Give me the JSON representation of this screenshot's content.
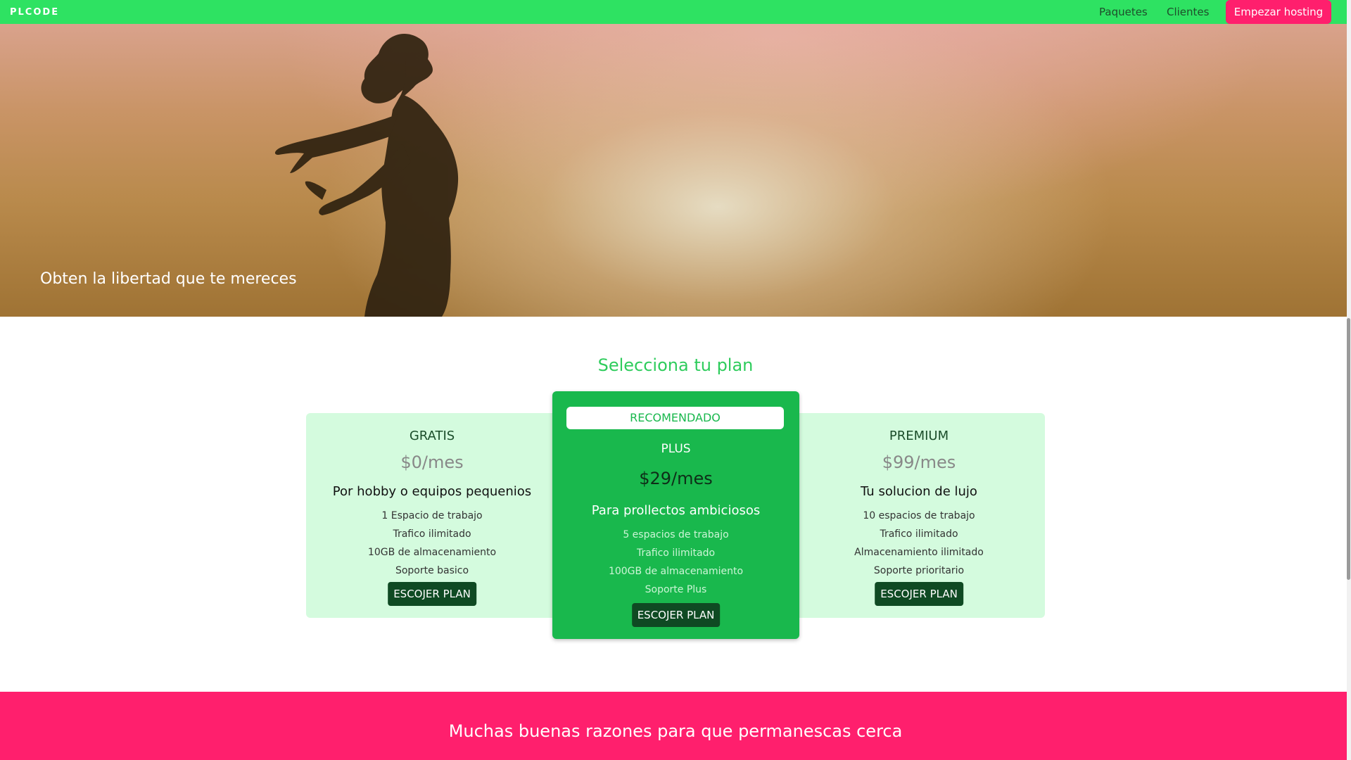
{
  "nav": {
    "brand": "PLCODE",
    "links": [
      "Paquetes",
      "Clientes"
    ],
    "cta": "Empezar hosting"
  },
  "hero": {
    "tagline": "Obten la libertad que te mereces"
  },
  "plans": {
    "title": "Selecciona tu plan",
    "cards": [
      {
        "name": "GRATIS",
        "price": "$0/mes",
        "tagline": "Por hobby o equipos pequenios",
        "features": [
          "1 Espacio de trabajo",
          "Trafico ilimitado",
          "10GB de almacenamiento",
          "Soporte basico"
        ],
        "button": "ESCOJER PLAN"
      },
      {
        "badge": "RECOMENDADO",
        "name": "PLUS",
        "price": "$29/mes",
        "tagline": "Para prollectos ambiciosos",
        "features": [
          "5 espacios de trabajo",
          "Trafico ilimitado",
          "100GB de almacenamiento",
          "Soporte Plus"
        ],
        "button": "ESCOJER PLAN"
      },
      {
        "name": "PREMIUM",
        "price": "$99/mes",
        "tagline": "Tu solucion de lujo",
        "features": [
          "10 espacios de trabajo",
          "Trafico ilimitado",
          "Almacenamiento ilimitado",
          "Soporte prioritario"
        ],
        "button": "ESCOJER PLAN"
      }
    ]
  },
  "reasons": {
    "title": "Muchas buenas razones para que permanescas cerca"
  },
  "colors": {
    "nav_green": "#2ee262",
    "accent_pink": "#ff1f6d",
    "plan_green": "#19b84d",
    "plan_light": "#d4fbde",
    "button_dark": "#0f4a23"
  },
  "icons": {
    "hero_image": "woman-silhouette-sunset-image"
  }
}
